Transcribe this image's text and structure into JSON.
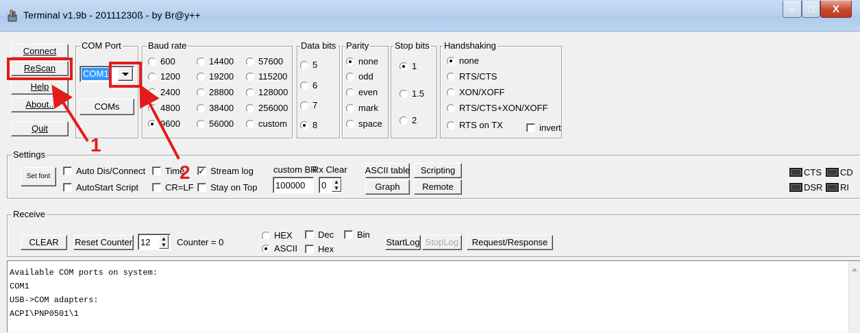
{
  "window": {
    "title": "Terminal v1.9b - 20111230ß - by Br@y++",
    "minimize_glyph": "–",
    "maximize_glyph": "□",
    "close_glyph": "X"
  },
  "top_buttons": {
    "connect": "Connect",
    "rescan": "ReScan",
    "help": "Help",
    "about": "About..",
    "quit": "Quit"
  },
  "com_port": {
    "legend": "COM Port",
    "selected": "COM1",
    "coms_button": "COMs"
  },
  "baud_rate": {
    "legend": "Baud rate",
    "options": [
      "600",
      "1200",
      "2400",
      "4800",
      "9600",
      "14400",
      "19200",
      "28800",
      "38400",
      "56000",
      "57600",
      "115200",
      "128000",
      "256000",
      "custom"
    ],
    "selected": "9600"
  },
  "data_bits": {
    "legend": "Data bits",
    "options": [
      "5",
      "6",
      "7",
      "8"
    ],
    "selected": "8"
  },
  "parity": {
    "legend": "Parity",
    "options": [
      "none",
      "odd",
      "even",
      "mark",
      "space"
    ],
    "selected": "none"
  },
  "stop_bits": {
    "legend": "Stop bits",
    "options": [
      "1",
      "1.5",
      "2"
    ],
    "selected": "1"
  },
  "handshaking": {
    "legend": "Handshaking",
    "options": [
      "none",
      "RTS/CTS",
      "XON/XOFF",
      "RTS/CTS+XON/XOFF",
      "RTS on TX"
    ],
    "selected": "none",
    "invert_label": "invert"
  },
  "settings": {
    "legend": "Settings",
    "set_font": "Set font",
    "auto_dis_connect": "Auto Dis/Connect",
    "autostart_script": "AutoStart Script",
    "time": "Time",
    "cr_lf": "CR=LF",
    "stream_log": "Stream log",
    "stay_on_top": "Stay on Top",
    "custom_br_label": "custom BR",
    "custom_br_value": "100000",
    "rx_clear_label": "Rx Clear",
    "rx_clear_value": "0",
    "ascii_table": "ASCII table",
    "scripting": "Scripting",
    "graph": "Graph",
    "remote": "Remote",
    "lamps": [
      "CTS",
      "CD",
      "DSR",
      "RI"
    ]
  },
  "receive": {
    "legend": "Receive",
    "clear": "CLEAR",
    "reset_counter": "Reset Counter",
    "counter_spin_value": "12",
    "counter_text": "Counter = 0",
    "hex": "HEX",
    "ascii": "ASCII",
    "dec": "Dec",
    "hex_check": "Hex",
    "bin": "Bin",
    "startlog": "StartLog",
    "stoplog": "StopLog",
    "request_response": "Request/Response"
  },
  "output_lines": [
    "Available COM ports on system:",
    "COM1",
    "USB->COM adapters:",
    "ACPI\\PNP0501\\1"
  ],
  "annotations": {
    "label_1": "1",
    "label_2": "2"
  },
  "colors": {
    "annotation_red": "#e41b1b",
    "titlebar": "#b9d1ef",
    "selection_blue": "#3399ff"
  }
}
